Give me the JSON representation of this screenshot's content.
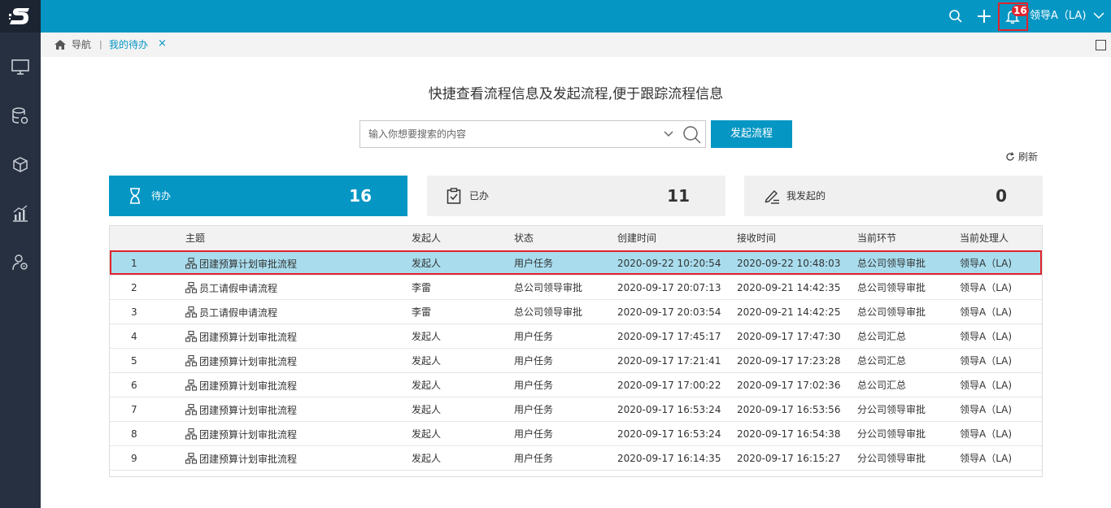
{
  "app": {
    "logo_name": "s-logo",
    "brand_color": "#0596c4",
    "sidebar_color": "#263040",
    "alert_color": "#e0242c"
  },
  "sidebar": {
    "items": [
      {
        "icon": "monitor-icon"
      },
      {
        "icon": "database-settings-icon"
      },
      {
        "icon": "cubes-icon"
      },
      {
        "icon": "bar-chart-icon"
      },
      {
        "icon": "user-settings-icon"
      }
    ]
  },
  "header": {
    "notification_count": "16",
    "user_name": "领导A（LA)"
  },
  "breadcrumb": {
    "home_label": "导航",
    "separator": "|",
    "tab_label": "我的待办",
    "close_symbol": "×"
  },
  "main": {
    "headline": "快捷查看流程信息及发起流程,便于跟踪流程信息",
    "search_placeholder": "输入你想要搜索的内容",
    "start_button": "发起流程",
    "refresh_label": "刷新"
  },
  "cards": [
    {
      "label": "待办",
      "count": "16",
      "icon": "hourglass-icon"
    },
    {
      "label": "已办",
      "count": "11",
      "icon": "clipboard-check-icon"
    },
    {
      "label": "我发起的",
      "count": "0",
      "icon": "pen-edit-icon"
    }
  ],
  "table": {
    "columns": [
      "",
      "主题",
      "发起人",
      "状态",
      "创建时间",
      "接收时间",
      "当前环节",
      "当前处理人"
    ],
    "rows": [
      [
        "1",
        "团建预算计划审批流程",
        "发起人",
        "用户任务",
        "2020-09-22 10:20:54",
        "2020-09-22 10:48:03",
        "总公司领导审批",
        "领导A（LA)"
      ],
      [
        "2",
        "员工请假申请流程",
        "李雷",
        "总公司领导审批",
        "2020-09-17 20:07:13",
        "2020-09-21 14:42:35",
        "总公司领导审批",
        "领导A（LA)"
      ],
      [
        "3",
        "员工请假申请流程",
        "李雷",
        "总公司领导审批",
        "2020-09-17 20:03:54",
        "2020-09-21 14:42:25",
        "总公司领导审批",
        "领导A（LA)"
      ],
      [
        "4",
        "团建预算计划审批流程",
        "发起人",
        "用户任务",
        "2020-09-17 17:45:17",
        "2020-09-17 17:47:30",
        "总公司汇总",
        "领导A（LA)"
      ],
      [
        "5",
        "团建预算计划审批流程",
        "发起人",
        "用户任务",
        "2020-09-17 17:21:41",
        "2020-09-17 17:23:28",
        "总公司汇总",
        "领导A（LA)"
      ],
      [
        "6",
        "团建预算计划审批流程",
        "发起人",
        "用户任务",
        "2020-09-17 17:00:22",
        "2020-09-17 17:02:36",
        "总公司汇总",
        "领导A（LA)"
      ],
      [
        "7",
        "团建预算计划审批流程",
        "发起人",
        "用户任务",
        "2020-09-17 16:53:24",
        "2020-09-17 16:53:56",
        "分公司领导审批",
        "领导A（LA)"
      ],
      [
        "8",
        "团建预算计划审批流程",
        "发起人",
        "用户任务",
        "2020-09-17 16:53:24",
        "2020-09-17 16:54:38",
        "分公司领导审批",
        "领导A（LA)"
      ],
      [
        "9",
        "团建预算计划审批流程",
        "发起人",
        "用户任务",
        "2020-09-17 16:14:35",
        "2020-09-17 16:15:27",
        "分公司领导审批",
        "领导A（LA)"
      ]
    ]
  }
}
